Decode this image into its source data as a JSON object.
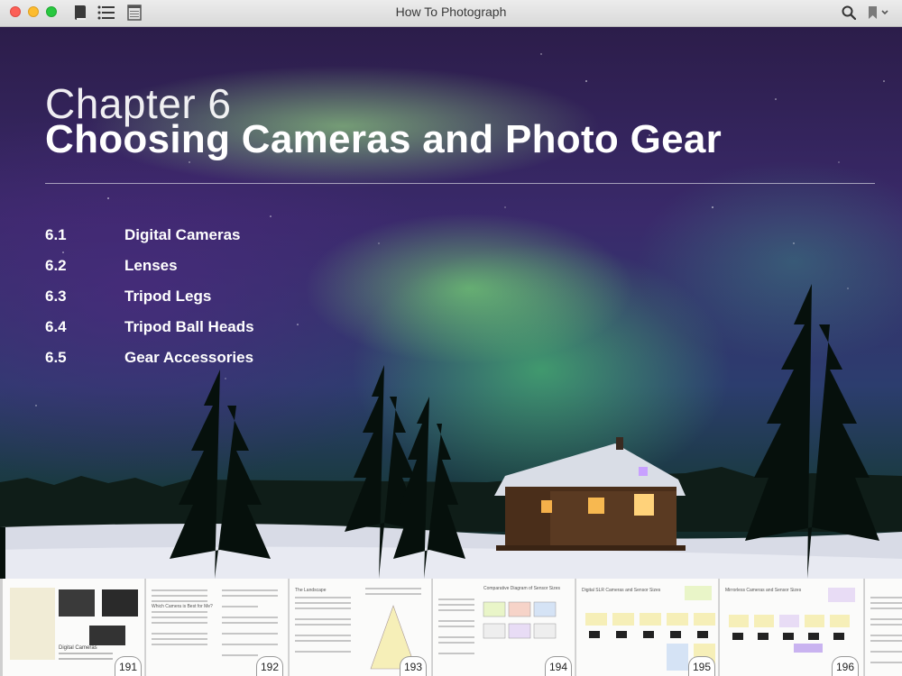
{
  "window": {
    "title": "How To Photograph"
  },
  "toolbar": {
    "icons": [
      "library-icon",
      "toc-list-icon",
      "notes-icon",
      "search-icon",
      "bookmark-icon"
    ]
  },
  "chapter": {
    "label": "Chapter 6",
    "title": "Choosing Cameras and Photo Gear",
    "sections": [
      {
        "number": "6.1",
        "title": "Digital Cameras"
      },
      {
        "number": "6.2",
        "title": "Lenses"
      },
      {
        "number": "6.3",
        "title": "Tripod Legs"
      },
      {
        "number": "6.4",
        "title": "Tripod Ball Heads"
      },
      {
        "number": "6.5",
        "title": "Gear Accessories"
      }
    ]
  },
  "thumbnails": [
    {
      "page": "191",
      "heading": "Digital Cameras"
    },
    {
      "page": "192",
      "heading": "Which Camera is Best for Me?"
    },
    {
      "page": "193",
      "heading": "The Landscape"
    },
    {
      "page": "194",
      "heading": "Comparative Diagram of Sensor Sizes"
    },
    {
      "page": "195",
      "heading": "Digital SLR Cameras and Sensor Sizes"
    },
    {
      "page": "196",
      "heading": "Mirrorless Cameras and Sensor Sizes"
    }
  ],
  "colors": {
    "close": "#fc5f57",
    "minimize": "#fdbc2e",
    "maximize": "#28c840"
  }
}
